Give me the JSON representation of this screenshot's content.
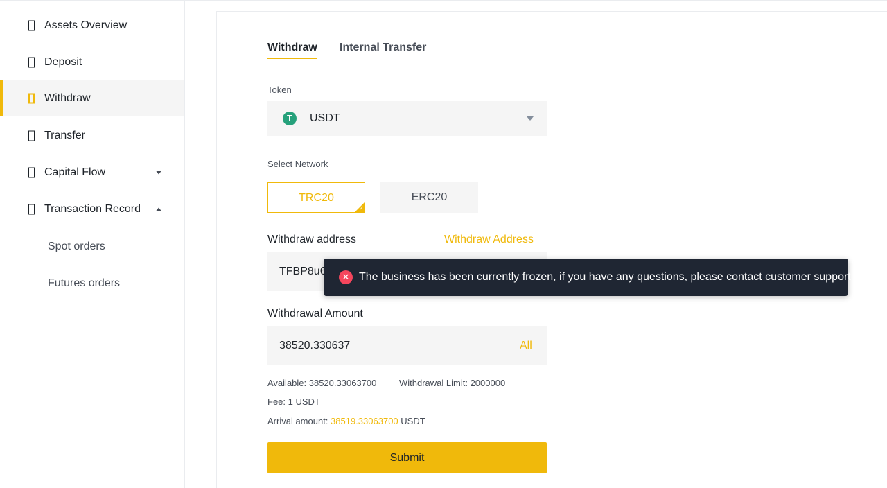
{
  "sidebar": {
    "items": [
      {
        "label": "Assets Overview"
      },
      {
        "label": "Deposit"
      },
      {
        "label": "Withdraw"
      },
      {
        "label": "Transfer"
      },
      {
        "label": "Capital Flow"
      },
      {
        "label": "Transaction Record"
      }
    ],
    "sub_items": [
      {
        "label": "Spot orders"
      },
      {
        "label": "Futures orders"
      }
    ]
  },
  "tabs": {
    "withdraw": "Withdraw",
    "internal_transfer": "Internal Transfer"
  },
  "token": {
    "label": "Token",
    "selected": "USDT",
    "icon": "tether-icon"
  },
  "network": {
    "label": "Select Network",
    "options": [
      "TRC20",
      "ERC20"
    ],
    "selected": "TRC20"
  },
  "address": {
    "label": "Withdraw address",
    "book_link": "Withdraw Address",
    "value": "TFBP8u6"
  },
  "amount": {
    "label": "Withdrawal Amount",
    "value": "38520.330637",
    "all_label": "All"
  },
  "info": {
    "available": "Available: 38520.33063700",
    "limit": "Withdrawal Limit: 2000000",
    "fee": "Fee: 1 USDT",
    "arrival_label": "Arrival amount: ",
    "arrival_value": "38519.33063700",
    "arrival_unit": " USDT"
  },
  "submit_label": "Submit",
  "toast": {
    "message": "The business has been currently frozen, if you have any questions, please contact customer support",
    "icon": "error-icon"
  },
  "colors": {
    "accent": "#f0b90b",
    "error": "#f6465d",
    "tether": "#26a17b",
    "toast_bg": "#1f2633"
  }
}
